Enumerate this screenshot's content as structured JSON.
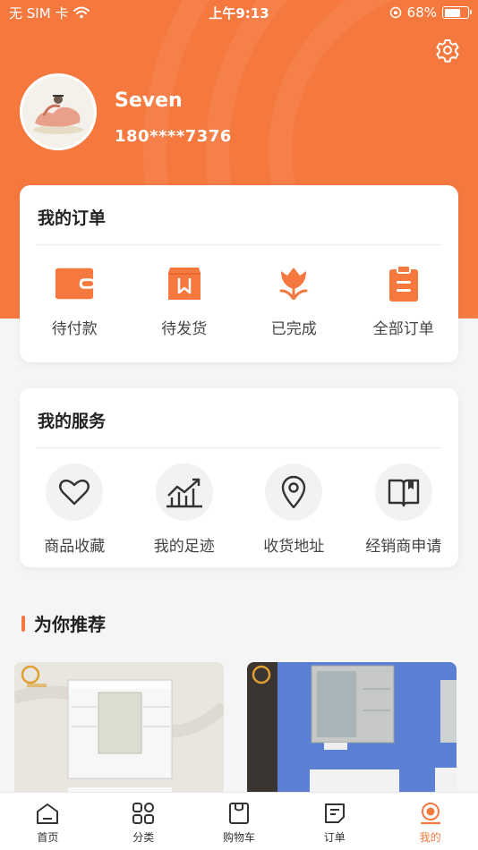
{
  "status_bar": {
    "carrier": "无 SIM 卡",
    "time": "上午9:13",
    "battery_percent": "68%",
    "battery_level": 0.68
  },
  "profile": {
    "name": "Seven",
    "phone": "180****7376"
  },
  "orders": {
    "title": "我的订单",
    "items": [
      {
        "label": "待付款",
        "icon": "wallet-icon"
      },
      {
        "label": "待发货",
        "icon": "package-icon"
      },
      {
        "label": "已完成",
        "icon": "tulip-icon"
      },
      {
        "label": "全部订单",
        "icon": "clipboard-icon"
      }
    ]
  },
  "services": {
    "title": "我的服务",
    "items": [
      {
        "label": "商品收藏",
        "icon": "heart-icon"
      },
      {
        "label": "我的足迹",
        "icon": "trend-chart-icon"
      },
      {
        "label": "收货地址",
        "icon": "location-pin-icon"
      },
      {
        "label": "经销商申请",
        "icon": "book-icon"
      }
    ]
  },
  "recommend": {
    "title": "为你推荐"
  },
  "tabbar": {
    "items": [
      {
        "label": "首页",
        "icon": "home-icon",
        "active": false
      },
      {
        "label": "分类",
        "icon": "category-grid-icon",
        "active": false
      },
      {
        "label": "购物车",
        "icon": "shopping-bag-icon",
        "active": false
      },
      {
        "label": "订单",
        "icon": "order-list-icon",
        "active": false
      },
      {
        "label": "我的",
        "icon": "profile-icon",
        "active": true
      }
    ]
  },
  "colors": {
    "accent": "#f5793f",
    "background": "#f5f5f5"
  }
}
